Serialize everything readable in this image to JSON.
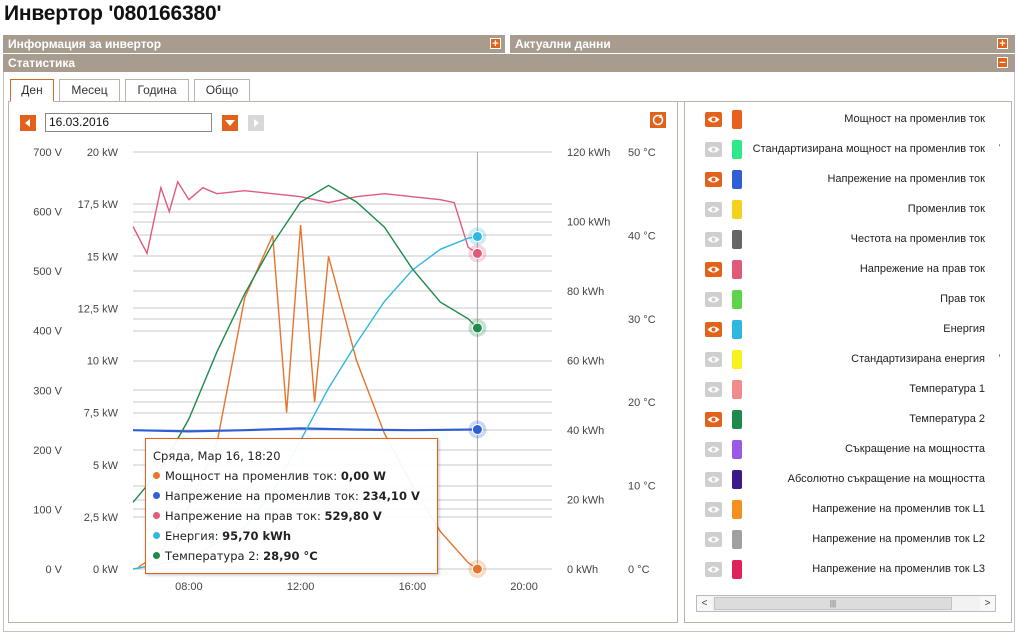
{
  "title": "Инвертор '080166380'",
  "sections": {
    "info": "Информация за инвертор",
    "current": "Актуални данни",
    "stats": "Статистика",
    "plus": "+",
    "minus": "−"
  },
  "tabs": [
    "Ден",
    "Месец",
    "Година",
    "Общо"
  ],
  "date": "16.03.2016",
  "chart_data": {
    "type": "line",
    "x_ticks": [
      "08:00",
      "12:00",
      "16:00",
      "20:00"
    ],
    "y_axes": [
      {
        "name": "voltage",
        "ticks": [
          "700 V",
          "600 V",
          "500 V",
          "400 V",
          "300 V",
          "200 V",
          "100 V",
          "0 V"
        ],
        "range": [
          0,
          700
        ]
      },
      {
        "name": "power",
        "ticks": [
          "20 kW",
          "17,5 kW",
          "15 kW",
          "12,5 kW",
          "10 kW",
          "7,5 kW",
          "5 kW",
          "2,5 kW",
          "0 kW"
        ],
        "range": [
          0,
          20
        ]
      },
      {
        "name": "energy",
        "ticks": [
          "120 kWh",
          "100 kWh",
          "80 kWh",
          "60 kWh",
          "40 kWh",
          "20 kWh",
          "0 kWh"
        ],
        "range": [
          0,
          120
        ]
      },
      {
        "name": "temperature",
        "ticks": [
          "50 °C",
          "40 °C",
          "30 °C",
          "20 °C",
          "10 °C",
          "0 °C"
        ],
        "range": [
          0,
          50
        ]
      }
    ],
    "grid": true,
    "series": [
      {
        "name": "Мощност на променлив ток",
        "axis": "power",
        "color": "#e8732c",
        "x": [
          6.2,
          7.0,
          8.0,
          9.0,
          9.5,
          10.0,
          10.5,
          11.0,
          11.5,
          12.0,
          12.5,
          13.0,
          13.5,
          14.0,
          15.0,
          16.0,
          17.0,
          18.0,
          18.33
        ],
        "values": [
          0.1,
          0.8,
          3.0,
          6.0,
          9.5,
          13.0,
          14.5,
          16.0,
          7.5,
          16.5,
          8.0,
          15.0,
          12.5,
          10.0,
          6.5,
          4.0,
          1.8,
          0.3,
          0.0
        ]
      },
      {
        "name": "Напрежение на променлив ток",
        "axis": "voltage",
        "color": "#2f5fd6",
        "x": [
          6.0,
          8.0,
          10.0,
          12.0,
          14.0,
          16.0,
          18.33
        ],
        "values": [
          233,
          231,
          233,
          236,
          234,
          233,
          234.1
        ]
      },
      {
        "name": "Напрежение на прав ток",
        "axis": "voltage",
        "color": "#e05a7a",
        "x": [
          6.0,
          6.5,
          7.0,
          7.3,
          7.6,
          8.0,
          8.5,
          9.0,
          10.0,
          11.0,
          12.0,
          13.0,
          14.0,
          15.0,
          16.0,
          17.0,
          17.5,
          18.0,
          18.33
        ],
        "values": [
          575,
          530,
          640,
          600,
          650,
          620,
          640,
          630,
          635,
          630,
          625,
          615,
          625,
          630,
          625,
          620,
          615,
          540,
          529.8
        ]
      },
      {
        "name": "Енергия",
        "axis": "energy",
        "color": "#2eb8e0",
        "x": [
          6.0,
          8.0,
          10.0,
          11.0,
          12.0,
          13.0,
          14.0,
          15.0,
          16.0,
          17.0,
          18.0,
          18.33
        ],
        "values": [
          0,
          3,
          12,
          22,
          37,
          52,
          65,
          77,
          86,
          92,
          95.2,
          95.7
        ]
      },
      {
        "name": "Температура 2",
        "axis": "temperature",
        "color": "#1e8a4c",
        "x": [
          6.0,
          7.0,
          8.0,
          9.0,
          10.0,
          11.0,
          12.0,
          13.0,
          14.0,
          15.0,
          16.0,
          17.0,
          18.0,
          18.33
        ],
        "values": [
          8,
          12,
          18,
          26,
          33,
          39,
          44,
          46,
          44,
          41,
          36,
          32,
          30,
          28.9
        ]
      }
    ]
  },
  "tooltip": {
    "header": "Сряда, Мар 16, 18:20",
    "rows": [
      {
        "label": "Мощност на променлив ток:",
        "value": "0,00 W",
        "color": "#e8732c"
      },
      {
        "label": "Напрежение на променлив ток:",
        "value": "234,10 V",
        "color": "#2f5fd6"
      },
      {
        "label": "Напрежение на прав ток:",
        "value": "529,80 V",
        "color": "#e05a7a"
      },
      {
        "label": "Енергия:",
        "value": "95,70 kWh",
        "color": "#2eb8e0"
      },
      {
        "label": "Температура 2:",
        "value": "28,90 °C",
        "color": "#1e8a4c"
      }
    ]
  },
  "legend": [
    {
      "label": "Мощност на променлив ток",
      "color": "#e8601c",
      "visible": true
    },
    {
      "label": "Стандартизирана мощност на променлив ток",
      "color": "#2ee88a",
      "visible": false,
      "suffix": "V"
    },
    {
      "label": "Напрежение на променлив ток",
      "color": "#2f5fd6",
      "visible": true
    },
    {
      "label": "Променлив ток",
      "color": "#f2d21c",
      "visible": false
    },
    {
      "label": "Честота на променлив ток",
      "color": "#666666",
      "visible": false
    },
    {
      "label": "Напрежение на прав ток",
      "color": "#e05a7a",
      "visible": true
    },
    {
      "label": "Прав ток",
      "color": "#5fd44a",
      "visible": false
    },
    {
      "label": "Енергия",
      "color": "#2eb8e0",
      "visible": true
    },
    {
      "label": "Стандартизирана енергия",
      "color": "#f7f21e",
      "visible": false,
      "suffix": "Wl"
    },
    {
      "label": "Температура 1",
      "color": "#f08c8c",
      "visible": false
    },
    {
      "label": "Температура 2",
      "color": "#1e8a4c",
      "visible": true
    },
    {
      "label": "Съкращение на мощността",
      "color": "#9b59e6",
      "visible": false
    },
    {
      "label": "Абсолютно съкращение на мощността",
      "color": "#3c1a8a",
      "visible": false
    },
    {
      "label": "Напрежение на променлив ток L1",
      "color": "#f5901e",
      "visible": false
    },
    {
      "label": "Напрежение на променлив ток L2",
      "color": "#a0a0a0",
      "visible": false
    },
    {
      "label": "Напрежение на променлив ток L3",
      "color": "#e0215a",
      "visible": false
    }
  ],
  "scroll_thumb": "|||"
}
